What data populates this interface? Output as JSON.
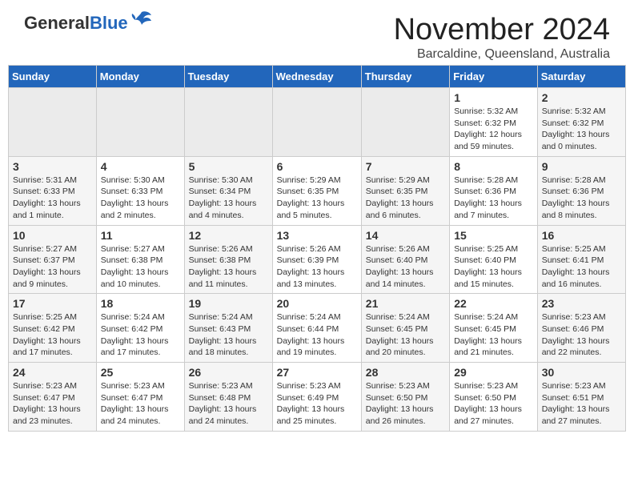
{
  "header": {
    "logo_general": "General",
    "logo_blue": "Blue",
    "month_title": "November 2024",
    "location": "Barcaldine, Queensland, Australia"
  },
  "days_of_week": [
    "Sunday",
    "Monday",
    "Tuesday",
    "Wednesday",
    "Thursday",
    "Friday",
    "Saturday"
  ],
  "weeks": [
    [
      {
        "day": "",
        "info": ""
      },
      {
        "day": "",
        "info": ""
      },
      {
        "day": "",
        "info": ""
      },
      {
        "day": "",
        "info": ""
      },
      {
        "day": "",
        "info": ""
      },
      {
        "day": "1",
        "info": "Sunrise: 5:32 AM\nSunset: 6:32 PM\nDaylight: 12 hours and 59 minutes."
      },
      {
        "day": "2",
        "info": "Sunrise: 5:32 AM\nSunset: 6:32 PM\nDaylight: 13 hours and 0 minutes."
      }
    ],
    [
      {
        "day": "3",
        "info": "Sunrise: 5:31 AM\nSunset: 6:33 PM\nDaylight: 13 hours and 1 minute."
      },
      {
        "day": "4",
        "info": "Sunrise: 5:30 AM\nSunset: 6:33 PM\nDaylight: 13 hours and 2 minutes."
      },
      {
        "day": "5",
        "info": "Sunrise: 5:30 AM\nSunset: 6:34 PM\nDaylight: 13 hours and 4 minutes."
      },
      {
        "day": "6",
        "info": "Sunrise: 5:29 AM\nSunset: 6:35 PM\nDaylight: 13 hours and 5 minutes."
      },
      {
        "day": "7",
        "info": "Sunrise: 5:29 AM\nSunset: 6:35 PM\nDaylight: 13 hours and 6 minutes."
      },
      {
        "day": "8",
        "info": "Sunrise: 5:28 AM\nSunset: 6:36 PM\nDaylight: 13 hours and 7 minutes."
      },
      {
        "day": "9",
        "info": "Sunrise: 5:28 AM\nSunset: 6:36 PM\nDaylight: 13 hours and 8 minutes."
      }
    ],
    [
      {
        "day": "10",
        "info": "Sunrise: 5:27 AM\nSunset: 6:37 PM\nDaylight: 13 hours and 9 minutes."
      },
      {
        "day": "11",
        "info": "Sunrise: 5:27 AM\nSunset: 6:38 PM\nDaylight: 13 hours and 10 minutes."
      },
      {
        "day": "12",
        "info": "Sunrise: 5:26 AM\nSunset: 6:38 PM\nDaylight: 13 hours and 11 minutes."
      },
      {
        "day": "13",
        "info": "Sunrise: 5:26 AM\nSunset: 6:39 PM\nDaylight: 13 hours and 13 minutes."
      },
      {
        "day": "14",
        "info": "Sunrise: 5:26 AM\nSunset: 6:40 PM\nDaylight: 13 hours and 14 minutes."
      },
      {
        "day": "15",
        "info": "Sunrise: 5:25 AM\nSunset: 6:40 PM\nDaylight: 13 hours and 15 minutes."
      },
      {
        "day": "16",
        "info": "Sunrise: 5:25 AM\nSunset: 6:41 PM\nDaylight: 13 hours and 16 minutes."
      }
    ],
    [
      {
        "day": "17",
        "info": "Sunrise: 5:25 AM\nSunset: 6:42 PM\nDaylight: 13 hours and 17 minutes."
      },
      {
        "day": "18",
        "info": "Sunrise: 5:24 AM\nSunset: 6:42 PM\nDaylight: 13 hours and 17 minutes."
      },
      {
        "day": "19",
        "info": "Sunrise: 5:24 AM\nSunset: 6:43 PM\nDaylight: 13 hours and 18 minutes."
      },
      {
        "day": "20",
        "info": "Sunrise: 5:24 AM\nSunset: 6:44 PM\nDaylight: 13 hours and 19 minutes."
      },
      {
        "day": "21",
        "info": "Sunrise: 5:24 AM\nSunset: 6:45 PM\nDaylight: 13 hours and 20 minutes."
      },
      {
        "day": "22",
        "info": "Sunrise: 5:24 AM\nSunset: 6:45 PM\nDaylight: 13 hours and 21 minutes."
      },
      {
        "day": "23",
        "info": "Sunrise: 5:23 AM\nSunset: 6:46 PM\nDaylight: 13 hours and 22 minutes."
      }
    ],
    [
      {
        "day": "24",
        "info": "Sunrise: 5:23 AM\nSunset: 6:47 PM\nDaylight: 13 hours and 23 minutes."
      },
      {
        "day": "25",
        "info": "Sunrise: 5:23 AM\nSunset: 6:47 PM\nDaylight: 13 hours and 24 minutes."
      },
      {
        "day": "26",
        "info": "Sunrise: 5:23 AM\nSunset: 6:48 PM\nDaylight: 13 hours and 24 minutes."
      },
      {
        "day": "27",
        "info": "Sunrise: 5:23 AM\nSunset: 6:49 PM\nDaylight: 13 hours and 25 minutes."
      },
      {
        "day": "28",
        "info": "Sunrise: 5:23 AM\nSunset: 6:50 PM\nDaylight: 13 hours and 26 minutes."
      },
      {
        "day": "29",
        "info": "Sunrise: 5:23 AM\nSunset: 6:50 PM\nDaylight: 13 hours and 27 minutes."
      },
      {
        "day": "30",
        "info": "Sunrise: 5:23 AM\nSunset: 6:51 PM\nDaylight: 13 hours and 27 minutes."
      }
    ]
  ]
}
